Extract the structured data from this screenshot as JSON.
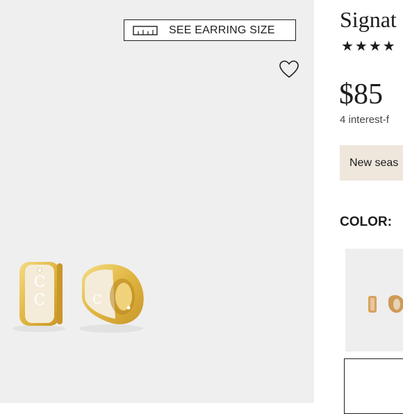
{
  "gallery": {
    "size_button_label": "SEE EARRING SIZE"
  },
  "product": {
    "title": "Signat",
    "rating_stars": "★★★★",
    "price": "$85",
    "installment_text": "4 interest-f",
    "promo_text": "New seas",
    "color_label": "COLOR:"
  },
  "colors": {
    "background": "#efefef",
    "promo_bg": "#efe6dc",
    "gold": "#e3bd4f",
    "ivory": "#f3ecd8"
  }
}
